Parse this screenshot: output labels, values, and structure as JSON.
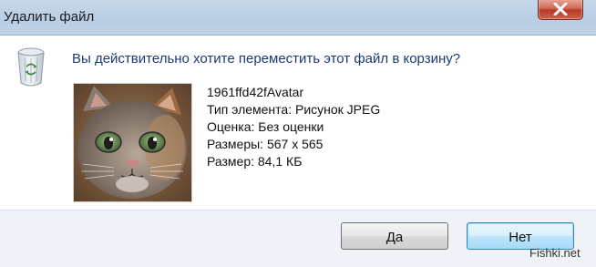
{
  "window": {
    "title": "Удалить файл"
  },
  "dialog": {
    "question": "Вы действительно хотите переместить этот файл в корзину?",
    "file_info": {
      "name": "1961ffd42fAvatar",
      "type": "Тип элемента: Рисунок JPEG",
      "rating": "Оценка: Без оценки",
      "dimensions": "Размеры: 567 x 565",
      "size": "Размер: 84,1 КБ"
    }
  },
  "buttons": {
    "yes_label": "Да",
    "no_label": "Нет"
  },
  "watermark": "Fishki.net",
  "icons": {
    "dialog_icon": "recycle-bin-icon",
    "close_icon": "close-icon"
  },
  "colors": {
    "question_text": "#1a3b73",
    "close_button": "#c8452f",
    "default_button_border": "#3c7fb1"
  }
}
